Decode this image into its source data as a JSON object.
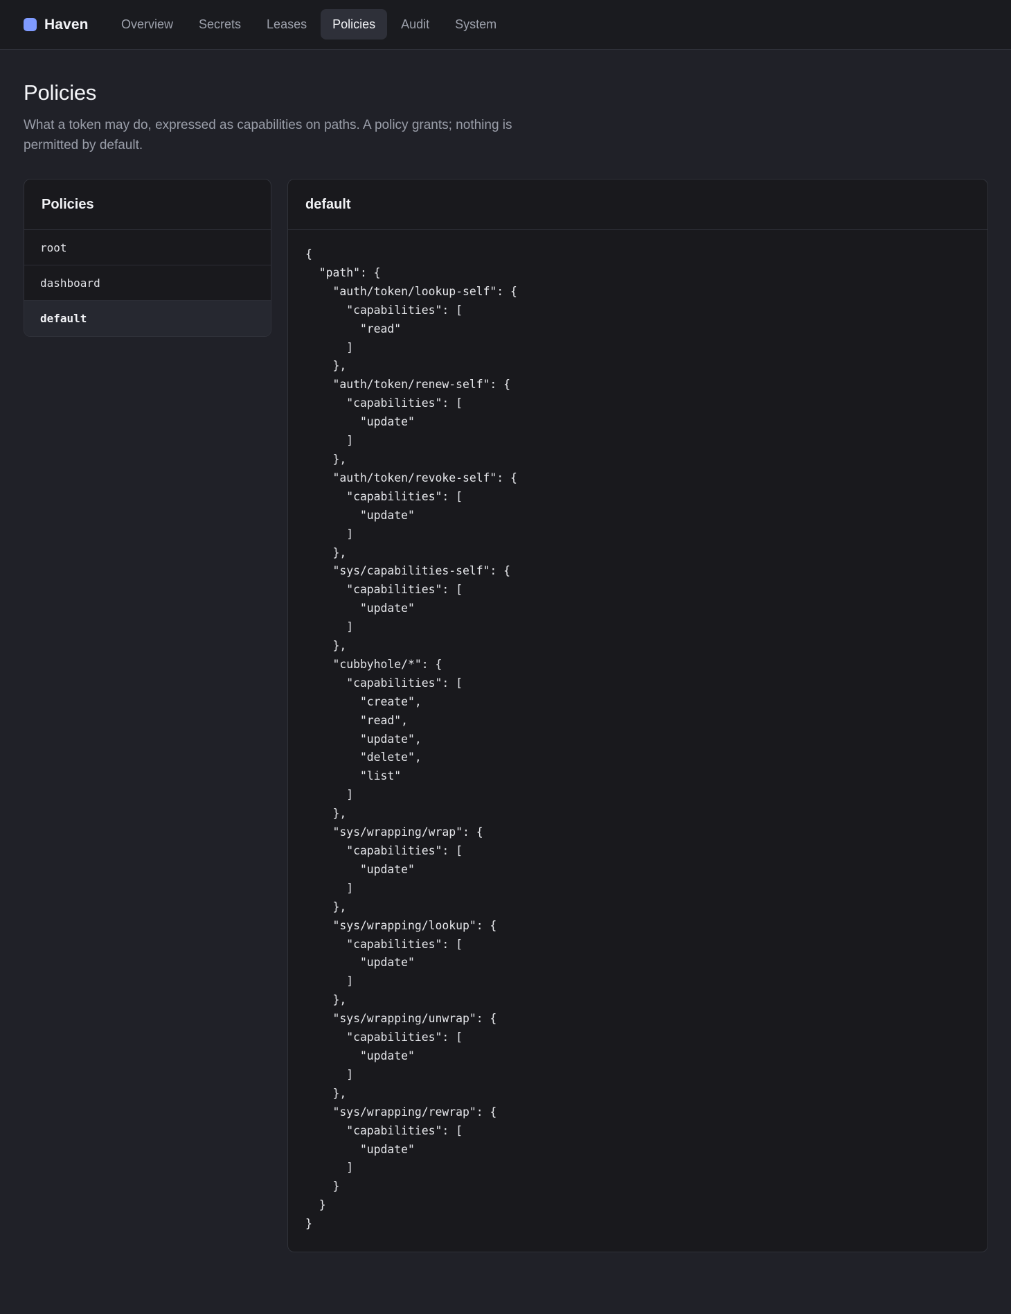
{
  "brand": {
    "name": "Haven",
    "accent_color": "#7f9bff"
  },
  "nav": {
    "items": [
      {
        "label": "Overview",
        "active": false
      },
      {
        "label": "Secrets",
        "active": false
      },
      {
        "label": "Leases",
        "active": false
      },
      {
        "label": "Policies",
        "active": true
      },
      {
        "label": "Audit",
        "active": false
      },
      {
        "label": "System",
        "active": false
      }
    ]
  },
  "page": {
    "title": "Policies",
    "description": "What a token may do, expressed as capabilities on paths. A policy grants; nothing is permitted by default."
  },
  "policy_list": {
    "header": "Policies",
    "items": [
      {
        "name": "root",
        "selected": false
      },
      {
        "name": "dashboard",
        "selected": false
      },
      {
        "name": "default",
        "selected": true
      }
    ]
  },
  "policy_detail": {
    "name": "default",
    "document": "{\n  \"path\": {\n    \"auth/token/lookup-self\": {\n      \"capabilities\": [\n        \"read\"\n      ]\n    },\n    \"auth/token/renew-self\": {\n      \"capabilities\": [\n        \"update\"\n      ]\n    },\n    \"auth/token/revoke-self\": {\n      \"capabilities\": [\n        \"update\"\n      ]\n    },\n    \"sys/capabilities-self\": {\n      \"capabilities\": [\n        \"update\"\n      ]\n    },\n    \"cubbyhole/*\": {\n      \"capabilities\": [\n        \"create\",\n        \"read\",\n        \"update\",\n        \"delete\",\n        \"list\"\n      ]\n    },\n    \"sys/wrapping/wrap\": {\n      \"capabilities\": [\n        \"update\"\n      ]\n    },\n    \"sys/wrapping/lookup\": {\n      \"capabilities\": [\n        \"update\"\n      ]\n    },\n    \"sys/wrapping/unwrap\": {\n      \"capabilities\": [\n        \"update\"\n      ]\n    },\n    \"sys/wrapping/rewrap\": {\n      \"capabilities\": [\n        \"update\"\n      ]\n    }\n  }\n}"
  }
}
